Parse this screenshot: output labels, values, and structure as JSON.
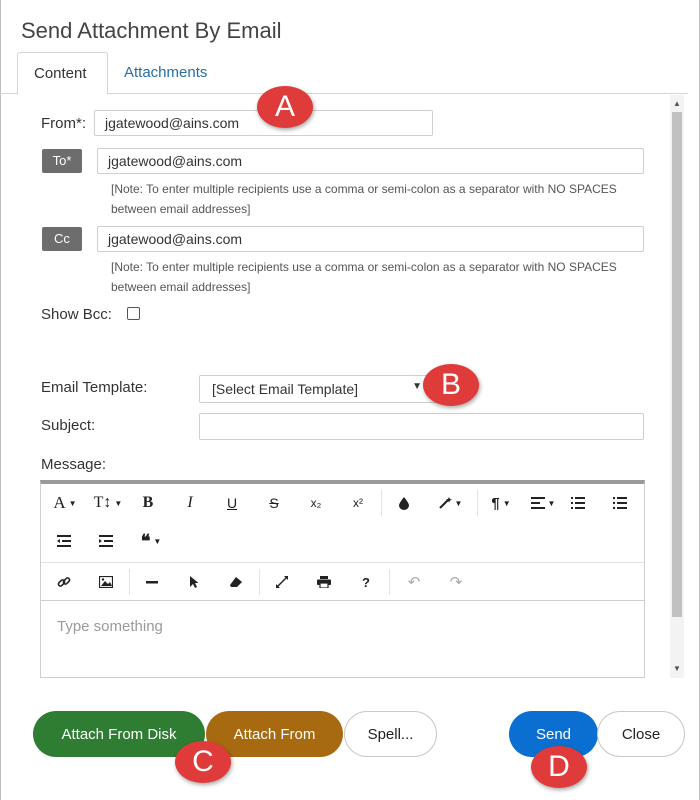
{
  "dialog": {
    "title": "Send Attachment By Email"
  },
  "tabs": [
    {
      "label": "Content"
    },
    {
      "label": "Attachments"
    }
  ],
  "form": {
    "from_label": "From*:",
    "from_value": "jgatewood@ains.com",
    "to_button": "To*",
    "to_value": "jgatewood@ains.com",
    "to_note": "[Note: To enter multiple recipients use a comma or semi-colon as a separator with NO SPACES between email addresses]",
    "cc_button": "Cc",
    "cc_value": "jgatewood@ains.com",
    "cc_note": "[Note: To enter multiple recipients use a comma or semi-colon as a separator with NO SPACES between email addresses]",
    "show_bcc_label": "Show Bcc:",
    "template_label": "Email Template:",
    "template_selected": "[Select Email Template]",
    "subject_label": "Subject:",
    "subject_value": "",
    "message_label": "Message:"
  },
  "editor": {
    "placeholder": "Type something",
    "toolbar": {
      "font_family": "A",
      "font_size": "T↕",
      "bold": "B",
      "italic": "I",
      "underline": "U",
      "strike": "S",
      "subscript": "x₂",
      "superscript": "x²",
      "help": "?"
    }
  },
  "footer": {
    "attach_disk": "Attach From Disk",
    "attach_from": "Attach From",
    "spell": "Spell...",
    "send": "Send",
    "close": "Close"
  },
  "markers": {
    "a": "A",
    "b": "B",
    "c": "C",
    "d": "D"
  },
  "colors": {
    "attach_disk_bg": "#2e7d32",
    "attach_from_bg": "#a86a10",
    "send_bg": "#0a6fd1",
    "marker_red": "#e03b3b",
    "tab_link": "#2a6ea6"
  }
}
